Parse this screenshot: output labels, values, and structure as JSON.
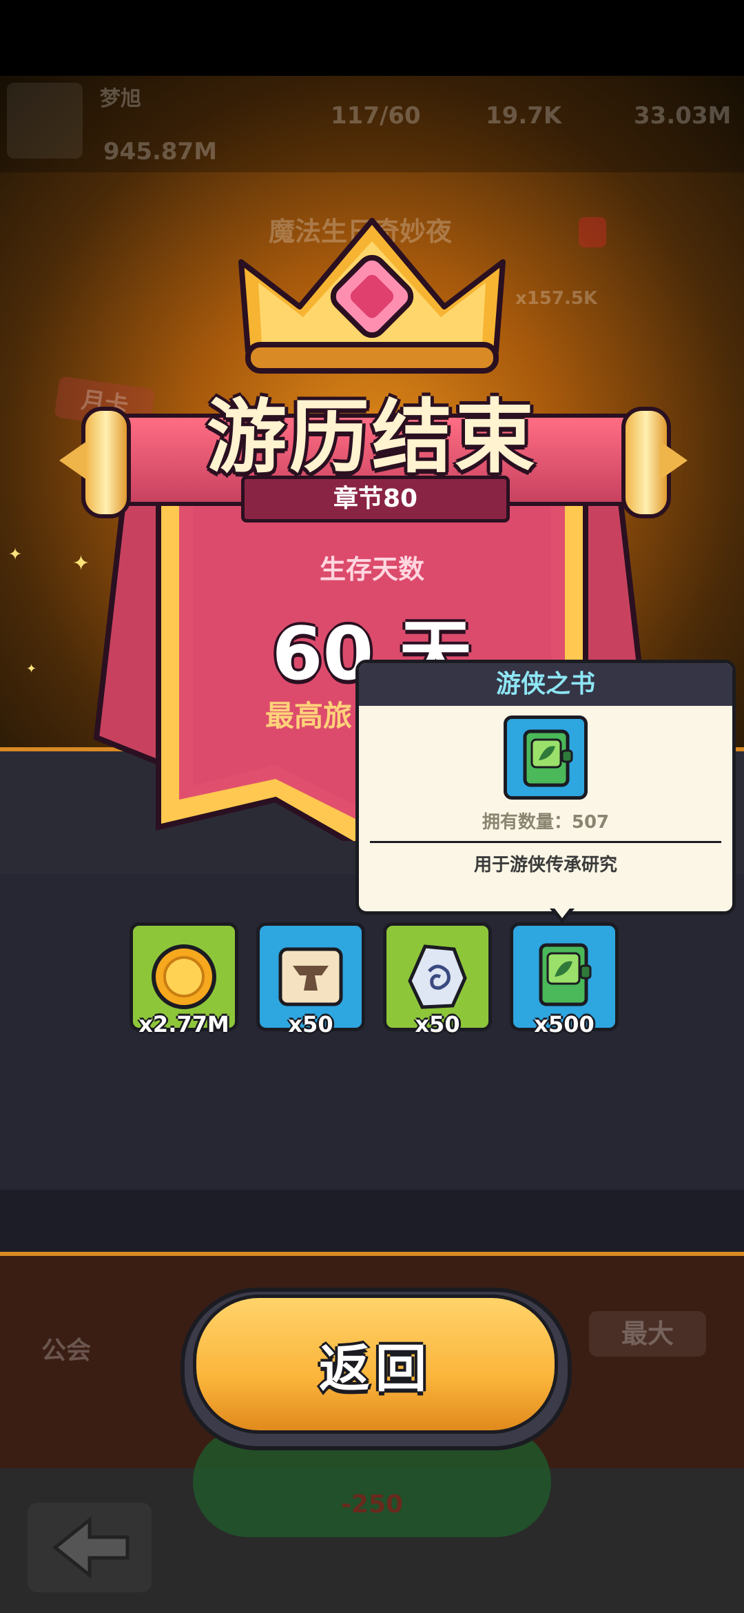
{
  "background": {
    "player_name": "梦旭",
    "power": "945.87M",
    "stamina": "117/60",
    "gems": "19.7K",
    "coins": "33.03M",
    "event_title": "魔法生日奇妙夜",
    "event_bonus": "x157.5K",
    "monthly_card": "月卡",
    "guild": "公会",
    "max_label": "最大",
    "energy_cost": "-250"
  },
  "result": {
    "title": "游历结束",
    "chapter": "章节80",
    "survive_label": "生存天数",
    "days": "60 天",
    "best_label": "最高旅"
  },
  "tooltip": {
    "title": "游侠之书",
    "owned": "拥有数量：507",
    "description": "用于游侠传承研究"
  },
  "rewards": [
    {
      "name": "coin",
      "qty": "x2.77M"
    },
    {
      "name": "anvil-scroll",
      "qty": "x50"
    },
    {
      "name": "rune-stone",
      "qty": "x50"
    },
    {
      "name": "ranger-book",
      "qty": "x500"
    }
  ],
  "buttons": {
    "return": "返回"
  },
  "colors": {
    "accent_orange": "#d98a25",
    "banner_pink": "#e0506e",
    "button_yellow": "#fbb53b"
  }
}
